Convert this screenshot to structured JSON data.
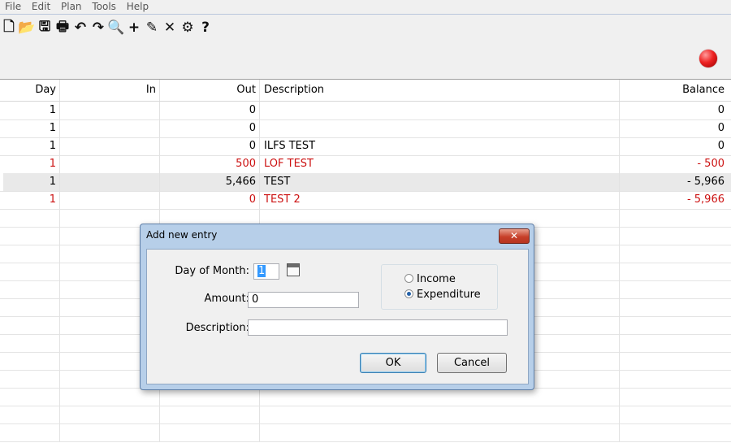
{
  "menu": [
    "File",
    "Edit",
    "Plan",
    "Tools",
    "Help"
  ],
  "toolbar": [
    {
      "name": "new-file-icon",
      "glyph": "🗋"
    },
    {
      "name": "open-folder-icon",
      "glyph": "📂"
    },
    {
      "name": "save-icon",
      "glyph": "🖫"
    },
    {
      "name": "print-icon",
      "glyph": "🖶"
    },
    {
      "name": "undo-icon",
      "glyph": "↶"
    },
    {
      "name": "redo-icon",
      "glyph": "↷"
    },
    {
      "name": "search-icon",
      "glyph": "🔍"
    },
    {
      "name": "add-icon",
      "glyph": "+"
    },
    {
      "name": "edit-pencil-icon",
      "glyph": "✎"
    },
    {
      "name": "delete-icon",
      "glyph": "✕"
    },
    {
      "name": "settings-gear-icon",
      "glyph": "⚙"
    },
    {
      "name": "help-icon",
      "glyph": "?"
    }
  ],
  "status_indicator_color": "#dd2222",
  "table": {
    "columns": {
      "day": "Day",
      "in": "In",
      "out": "Out",
      "description": "Description",
      "balance": "Balance"
    },
    "rows": [
      {
        "day": "1",
        "in": "",
        "out": "0",
        "description": "",
        "balance": "0",
        "color": "black"
      },
      {
        "day": "1",
        "in": "",
        "out": "0",
        "description": "",
        "balance": "0",
        "color": "black"
      },
      {
        "day": "1",
        "in": "",
        "out": "0",
        "description": "ILFS TEST",
        "balance": "0",
        "color": "black"
      },
      {
        "day": "1",
        "in": "",
        "out": "500",
        "description": "LOF TEST",
        "balance": "- 500",
        "color": "red"
      },
      {
        "day": "1",
        "in": "",
        "out": "5,466",
        "description": "TEST",
        "balance": "- 5,966",
        "color": "black",
        "selected": true
      },
      {
        "day": "1",
        "in": "",
        "out": "0",
        "description": "TEST 2",
        "balance": "- 5,966",
        "color": "red"
      }
    ],
    "empty_rows": 13
  },
  "dialog": {
    "title": "Add new entry",
    "close_glyph": "✕",
    "day_label": "Day of Month:",
    "day_value": "1",
    "amount_label": "Amount:",
    "amount_value": "0",
    "description_label": "Description:",
    "description_value": "",
    "income_label": "Income",
    "expenditure_label": "Expenditure",
    "selected_type": "expenditure",
    "ok_label": "OK",
    "cancel_label": "Cancel"
  }
}
